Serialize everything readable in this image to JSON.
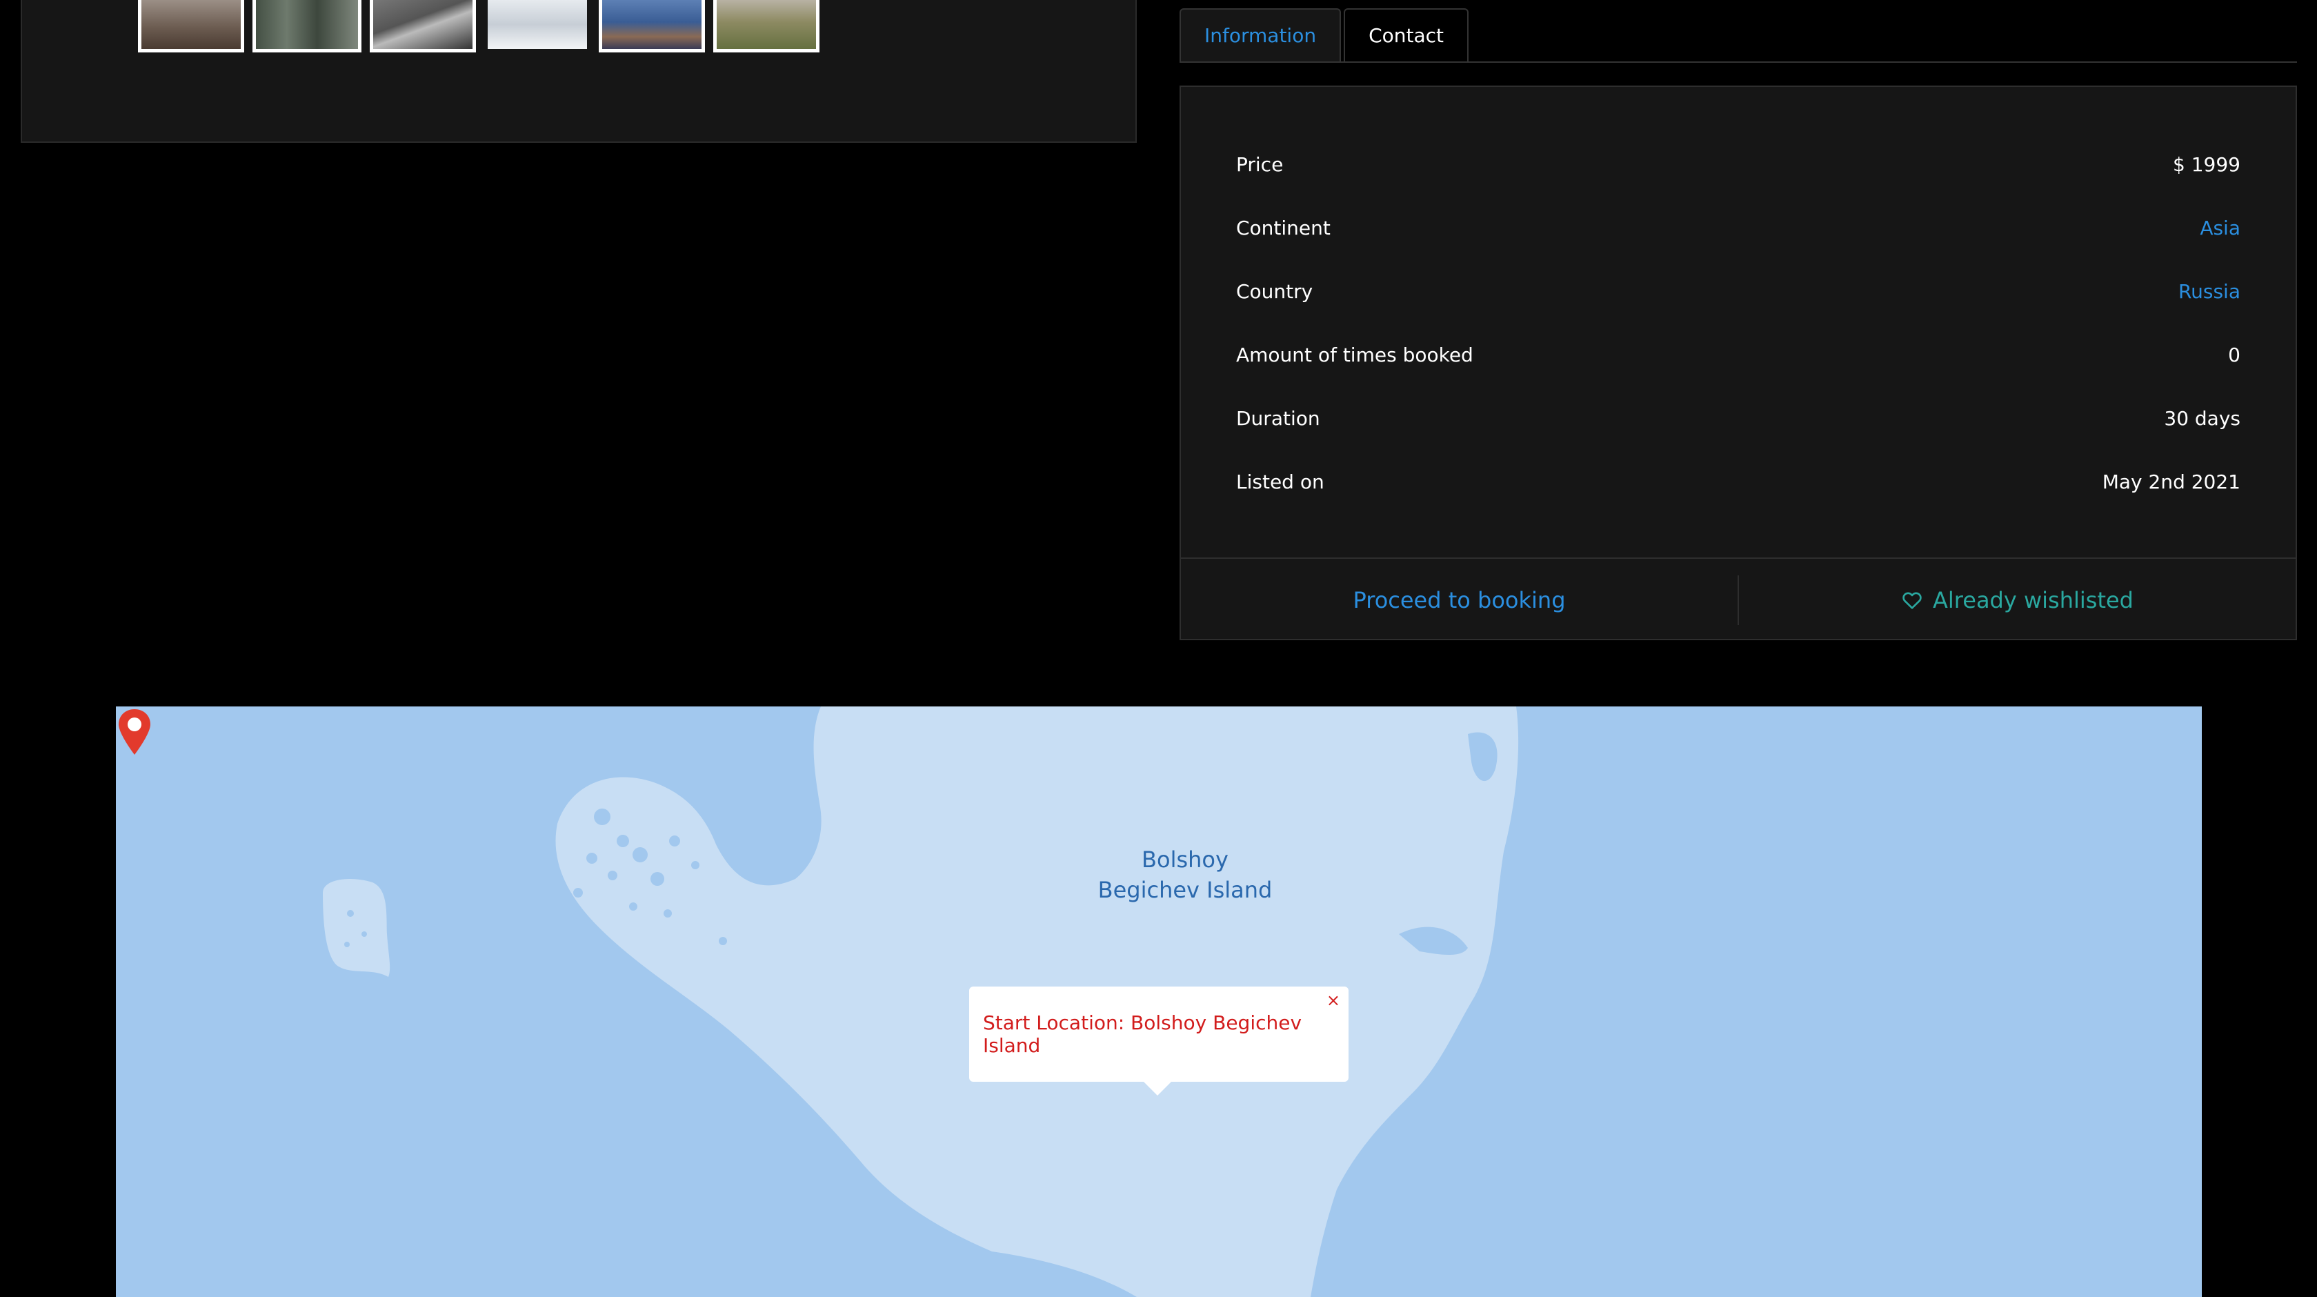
{
  "gallery": {
    "thumbnails": [
      {
        "alt": "landscape-thumbnail-1"
      },
      {
        "alt": "crowd-thumbnail-2"
      },
      {
        "alt": "ship-thumbnail-3"
      },
      {
        "alt": "snow-thumbnail-4"
      },
      {
        "alt": "city-thumbnail-5"
      },
      {
        "alt": "field-thumbnail-6"
      }
    ]
  },
  "tabs": [
    {
      "label": "Information",
      "active": true
    },
    {
      "label": "Contact",
      "active": false
    }
  ],
  "info": {
    "rows": [
      {
        "label": "Price",
        "value": "$ 1999"
      },
      {
        "label": "Continent",
        "value": "Asia"
      },
      {
        "label": "Country",
        "value": "Russia"
      },
      {
        "label": "Amount of times booked",
        "value": "0"
      },
      {
        "label": "Duration",
        "value": "30 days"
      },
      {
        "label": "Listed on",
        "value": "May 2nd 2021"
      }
    ],
    "booking_label": "Proceed to booking",
    "wishlist_label": "Already wishlisted",
    "wishlist_icon": "heart-icon"
  },
  "map": {
    "place_label_line1": "Bolshoy",
    "place_label_line2": "Begichev Island",
    "popup_text": "Start Location: Bolshoy Begichev Island",
    "close_glyph": "×",
    "marker_icon": "map-pin-icon",
    "water_color": "#a2c8ee",
    "land_color": "#c8def4"
  },
  "colors": {
    "accent": "#2b8fe0",
    "wishlist": "#2aa8a0",
    "popup_text": "#d21c1c",
    "panel_bg": "#161616"
  }
}
